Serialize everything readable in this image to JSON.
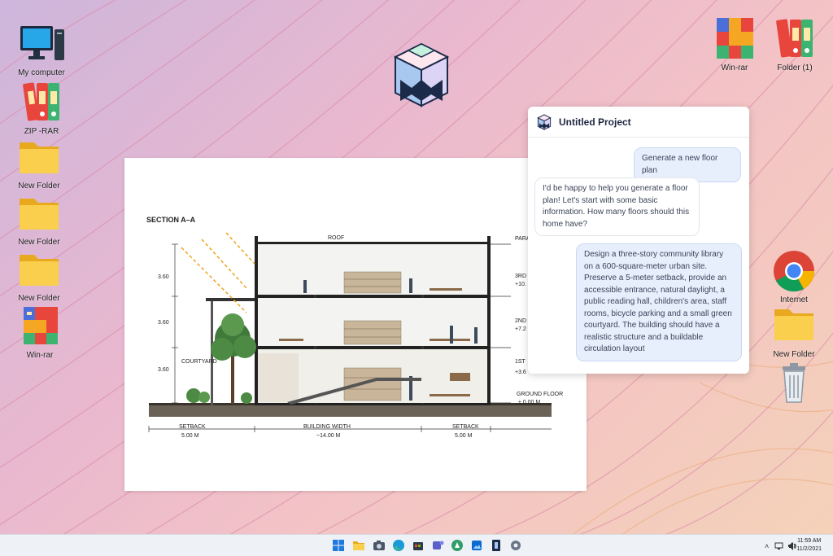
{
  "desktop": {
    "icons_left": [
      {
        "label": "My computer",
        "icon": "monitor-icon"
      },
      {
        "label": "ZIP -RAR",
        "icon": "binders-icon"
      },
      {
        "label": "New Folder",
        "icon": "folder-icon"
      },
      {
        "label": "New Folder",
        "icon": "folder-icon"
      },
      {
        "label": "New Folder",
        "icon": "folder-icon"
      },
      {
        "label": "Win-rar",
        "icon": "winrar-icon"
      }
    ],
    "icons_right": [
      {
        "label": "Win-rar",
        "icon": "winrar-icon"
      },
      {
        "label": "Folder (1)",
        "icon": "binders-icon"
      },
      {
        "label": "Internet",
        "icon": "chrome-icon"
      },
      {
        "label": "New Folder",
        "icon": "folder-icon"
      },
      {
        "label": "",
        "icon": "trash-icon"
      }
    ]
  },
  "drawing": {
    "title": "SECTION A–A",
    "labels": {
      "roof": "ROOF",
      "parapet": "PARA",
      "third": "3RD",
      "third_level": "+10.",
      "second": "2ND",
      "second_level": "+7.2",
      "first": "1ST",
      "first_level": "+3.6",
      "ground": "GROUND FLOOR",
      "ground_level": "± 0.00 M",
      "courtyard": "COURTYARD",
      "h1": "3.60",
      "h2": "3.60",
      "h3": "3.60",
      "setback_left": "SETBACK",
      "setback_left_val": "5.00 M",
      "building_width": "BUILDING WIDTH",
      "building_width_val": "~14.00 M",
      "setback_right": "SETBACK",
      "setback_right_val": "5.00 M"
    }
  },
  "chat": {
    "title": "Untitled Project",
    "messages": [
      {
        "role": "user",
        "text": "Generate a new floor plan"
      },
      {
        "role": "assistant",
        "text": "I'd be happy to help you generate a floor plan! Let's start with some basic information. How many floors should this home have?"
      },
      {
        "role": "user",
        "text": "Design a three-story community library on a 600-square-meter urban site. Preserve a 5-meter setback, provide an accessible entrance, natural daylight, a public reading hall, children's area, staff rooms, bicycle parking and a small green courtyard. The building should have a realistic structure and a buildable circulation layout"
      }
    ]
  },
  "taskbar": {
    "apps": [
      "windows-start-icon",
      "file-explorer-icon",
      "camera-icon",
      "edge-icon",
      "store-icon",
      "teams-icon",
      "maps-icon",
      "photos-icon",
      "app-active-icon",
      "settings-icon",
      "chrome-icon"
    ],
    "time": "11:59 AM",
    "date": "11/2/2021"
  },
  "colors": {
    "accent": "#2f6fe0",
    "user_bubble": "#e8effc",
    "folder": "#f7c948"
  }
}
